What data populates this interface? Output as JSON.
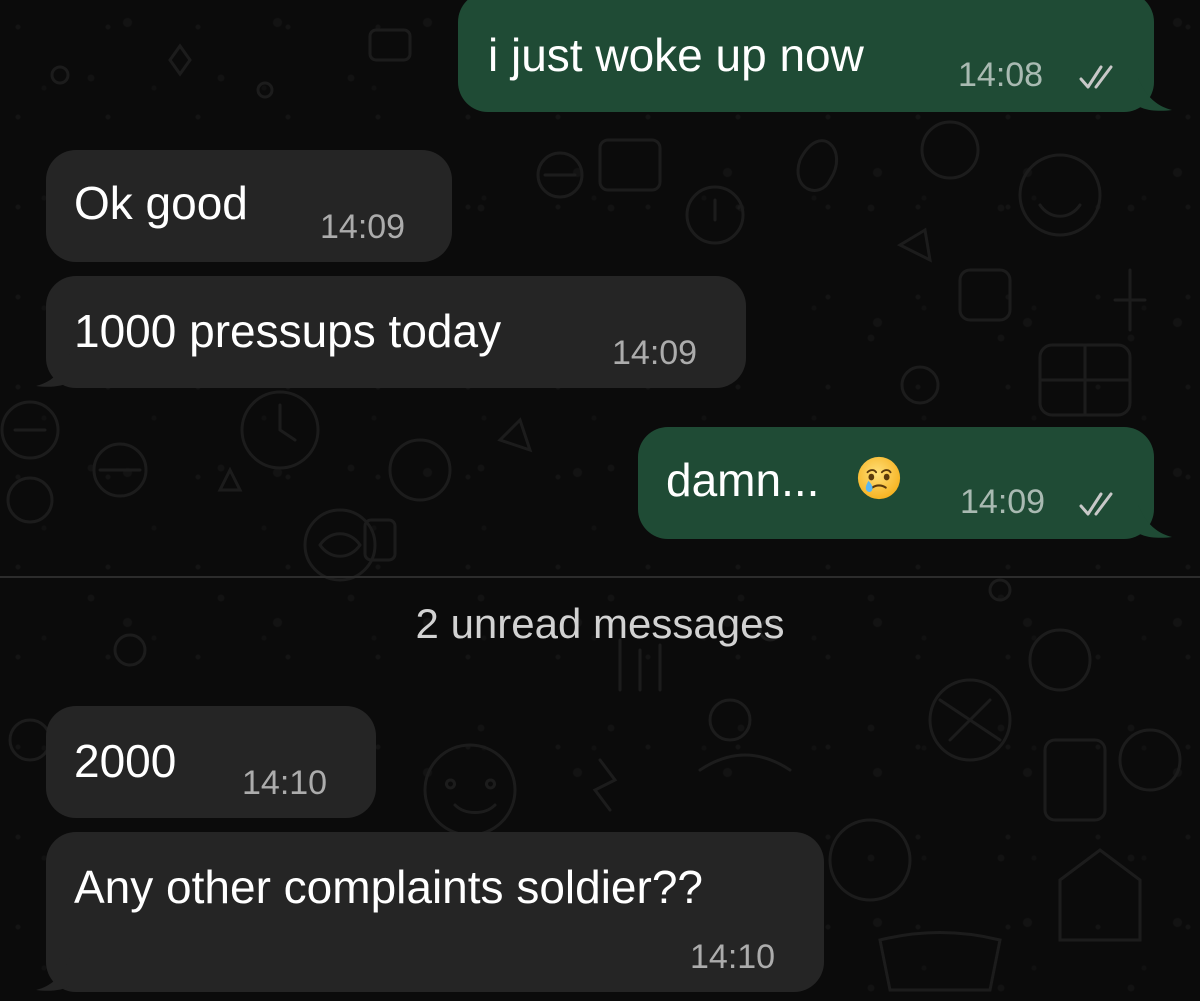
{
  "messages": [
    {
      "direction": "outgoing",
      "text": "i just woke up now",
      "time": "14:08",
      "status": "read"
    },
    {
      "direction": "incoming",
      "text": "Ok good",
      "time": "14:09"
    },
    {
      "direction": "incoming",
      "text": "1000 pressups today",
      "time": "14:09"
    },
    {
      "direction": "outgoing",
      "text": "damn...",
      "emoji": "face-holding-back-tears",
      "time": "14:09",
      "status": "read"
    },
    {
      "direction": "incoming",
      "text": "2000",
      "time": "14:10"
    },
    {
      "direction": "incoming",
      "text": "Any other complaints soldier??",
      "time": "14:10"
    }
  ],
  "unread_divider": {
    "label": "2 unread messages"
  },
  "icons": {
    "read_receipt": "double-check-icon",
    "emoji": "face-holding-back-tears-icon"
  },
  "colors": {
    "background": "#0b0b0b",
    "outgoing_bubble": "#1f4b35",
    "incoming_bubble": "#252525",
    "read_check": "#c8c8c8"
  }
}
